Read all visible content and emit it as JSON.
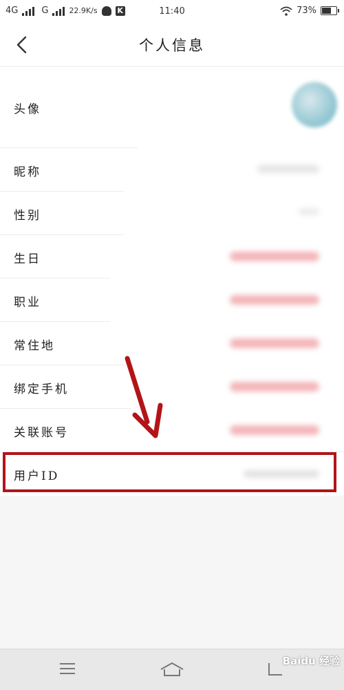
{
  "status_bar": {
    "network_1": "4G",
    "network_2": "G",
    "speed": "22.9K/s",
    "k_badge": "K",
    "time": "11:40",
    "battery": "73%",
    "battery_level": 0.73
  },
  "header": {
    "title": "个人信息",
    "back_icon": "chevron-left-icon"
  },
  "rows": {
    "avatar": {
      "label": "头像"
    },
    "nickname": {
      "label": "昵称"
    },
    "gender": {
      "label": "性别"
    },
    "birthday": {
      "label": "生日"
    },
    "occupation": {
      "label": "职业"
    },
    "residence": {
      "label": "常住地"
    },
    "phone": {
      "label": "绑定手机"
    },
    "linked": {
      "label": "关联账号"
    },
    "userid": {
      "label": "用户ID"
    }
  },
  "bottom_nav": {
    "menu_icon": "menu-icon",
    "home_icon": "home-icon",
    "back_icon": "back-icon"
  },
  "watermark": {
    "text": "Baidu 经验"
  },
  "colors": {
    "highlight": "#b31417",
    "blurred_value": "#f3b5b9",
    "avatar": "#8cc4d1"
  }
}
